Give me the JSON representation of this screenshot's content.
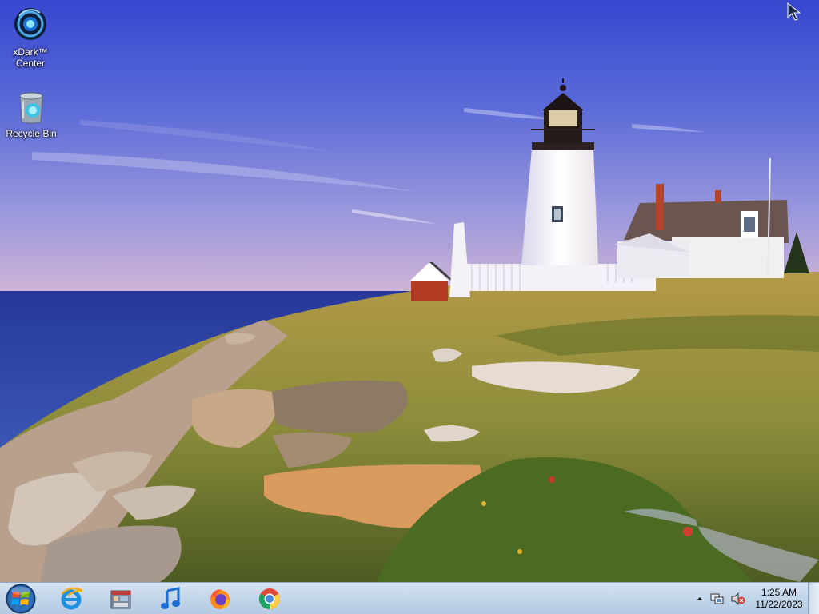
{
  "desktop": {
    "icons": [
      {
        "label_line1": "xDark™",
        "label_line2": "Center",
        "icon": "xdark-center-icon"
      },
      {
        "label": "Recycle Bin",
        "icon": "recycle-bin-icon"
      }
    ]
  },
  "taskbar": {
    "start_icon": "windows-start-orb-icon",
    "pinned": [
      {
        "icon": "internet-explorer-icon"
      },
      {
        "icon": "windows-media-center-icon"
      },
      {
        "icon": "itunes-music-icon"
      },
      {
        "icon": "firefox-icon"
      },
      {
        "icon": "chrome-icon"
      }
    ],
    "tray": {
      "icons": [
        "show-hidden-icons-chevron",
        "network-icon",
        "volume-muted-icon"
      ],
      "time": "1:25 AM",
      "date": "11/22/2023"
    }
  },
  "colors": {
    "sky_top": "#3a4fd0",
    "sky_bottom": "#b9a7d8",
    "sea": "#2c3f9a",
    "grass": "#8f8a3a",
    "taskbar": "#c3d6ea"
  }
}
